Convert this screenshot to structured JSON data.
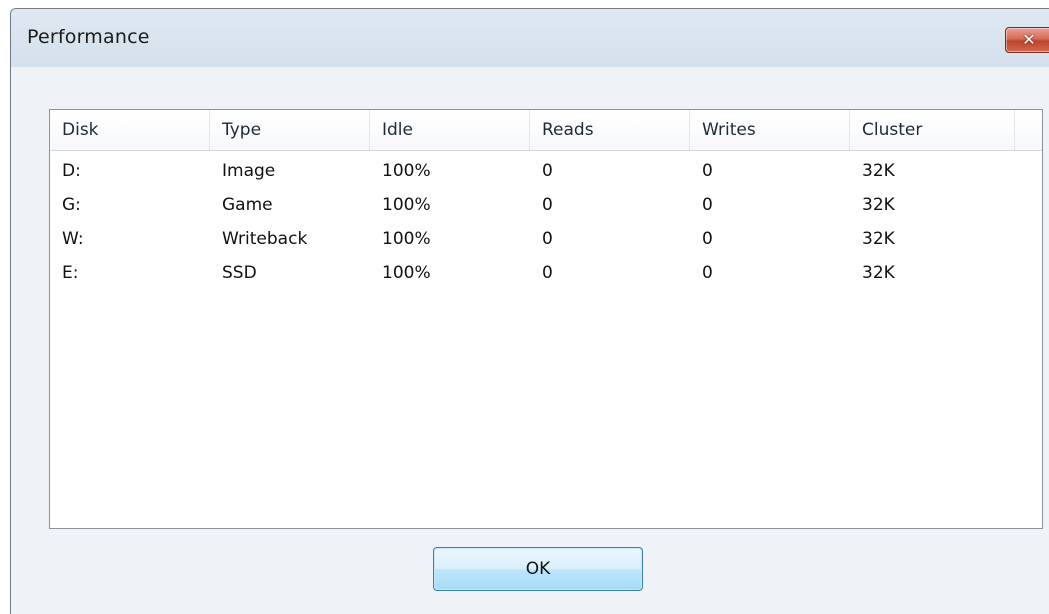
{
  "window": {
    "title": "Performance",
    "close_glyph": "✕"
  },
  "table": {
    "columns": [
      "Disk",
      "Type",
      "Idle",
      "Reads",
      "Writes",
      "Cluster"
    ],
    "rows": [
      [
        "D:",
        "Image",
        "100%",
        "0",
        "0",
        "32K"
      ],
      [
        "G:",
        "Game",
        "100%",
        "0",
        "0",
        "32K"
      ],
      [
        "W:",
        "Writeback",
        "100%",
        "0",
        "0",
        "32K"
      ],
      [
        "E:",
        "SSD",
        "100%",
        "0",
        "0",
        "32K"
      ]
    ]
  },
  "buttons": {
    "ok_label": "OK"
  },
  "colors": {
    "close_button": "#c8452c",
    "ok_button_border": "#3c7fb1"
  }
}
